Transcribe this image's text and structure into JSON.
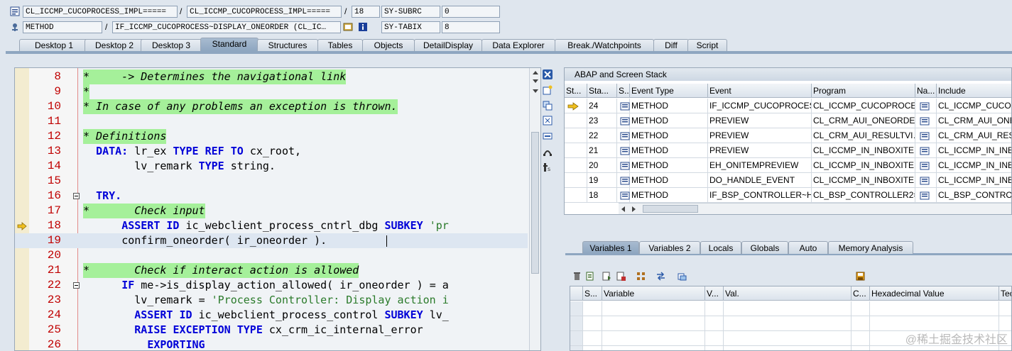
{
  "header": {
    "row1": {
      "program1": "CL_ICCMP_CUCOPROCESS_IMPL=====",
      "sep1": "/",
      "program2": "CL_ICCMP_CUCOPROCESS_IMPL=====",
      "sep2": "/",
      "line": "18",
      "var_name": "SY-SUBRC",
      "var_value": "0"
    },
    "row2": {
      "type": "METHOD",
      "sep": "/",
      "method": "IF_ICCMP_CUCOPROCESS~DISPLAY_ONEORDER (CL_IC…",
      "var_name": "SY-TABIX",
      "var_value": "8"
    }
  },
  "tabs": [
    "Desktop 1",
    "Desktop 2",
    "Desktop 3",
    "Standard",
    "Structures",
    "Tables",
    "Objects",
    "DetailDisplay",
    "Data Explorer",
    "Break./Watchpoints",
    "Diff",
    "Script"
  ],
  "active_tab": "Standard",
  "code_lines": [
    {
      "n": "8",
      "t": "*     -> Determines the navigational link",
      "c": true
    },
    {
      "n": "9",
      "t": "*",
      "c": true
    },
    {
      "n": "10",
      "t": "* In case of any problems an exception is thrown.",
      "c": true
    },
    {
      "n": "11",
      "t": "",
      "c": false
    },
    {
      "n": "12",
      "t": "* Definitions",
      "c": true
    },
    {
      "n": "13",
      "t": "  DATA: lr_ex TYPE REF TO cx_root,",
      "c": false
    },
    {
      "n": "14",
      "t": "        lv_remark TYPE string.",
      "c": false
    },
    {
      "n": "15",
      "t": "",
      "c": false
    },
    {
      "n": "16",
      "t": "  TRY.",
      "c": false
    },
    {
      "n": "17",
      "t": "*       Check input",
      "c": true
    },
    {
      "n": "18",
      "t": "      ASSERT ID ic_webclient_process_cntrl_dbg SUBKEY 'pr",
      "c": false
    },
    {
      "n": "19",
      "t": "      confirm_oneorder( ir_oneorder ).",
      "c": false
    },
    {
      "n": "20",
      "t": "",
      "c": false
    },
    {
      "n": "21",
      "t": "*       Check if interact action is allowed",
      "c": true
    },
    {
      "n": "22",
      "t": "      IF me->is_display_action_allowed( ir_oneorder ) = a",
      "c": false
    },
    {
      "n": "23",
      "t": "        lv_remark = 'Process Controller: Display action i",
      "c": false
    },
    {
      "n": "24",
      "t": "        ASSERT ID ic_webclient_process_control SUBKEY lv_",
      "c": false
    },
    {
      "n": "25",
      "t": "        RAISE EXCEPTION TYPE cx_crm_ic_internal_error",
      "c": false
    },
    {
      "n": "26",
      "t": "          EXPORTING",
      "c": false
    }
  ],
  "stack": {
    "title": "ABAP and Screen Stack",
    "columns": [
      "St...",
      "Sta...",
      "S...",
      "Event Type",
      "Event",
      "Program",
      "Na...",
      "Include"
    ],
    "rows": [
      {
        "st": "",
        "sta": "24",
        "type": "METHOD",
        "event": "IF_ICCMP_CUCOPROCES…",
        "program": "CL_ICCMP_CUCOPROCES…",
        "include": "CL_ICCMP_CUCOP"
      },
      {
        "st": "",
        "sta": "23",
        "type": "METHOD",
        "event": "PREVIEW",
        "program": "CL_CRM_AUI_ONEORDE…",
        "include": "CL_CRM_AUI_ONEC"
      },
      {
        "st": "",
        "sta": "22",
        "type": "METHOD",
        "event": "PREVIEW",
        "program": "CL_CRM_AUI_RESULTVI…",
        "include": "CL_CRM_AUI_RESU"
      },
      {
        "st": "",
        "sta": "21",
        "type": "METHOD",
        "event": "PREVIEW",
        "program": "CL_ICCMP_IN_INBOXITE…",
        "include": "CL_ICCMP_IN_INBO"
      },
      {
        "st": "",
        "sta": "20",
        "type": "METHOD",
        "event": "EH_ONITEMPREVIEW",
        "program": "CL_ICCMP_IN_INBOXITE…",
        "include": "CL_ICCMP_IN_INBO"
      },
      {
        "st": "",
        "sta": "19",
        "type": "METHOD",
        "event": "DO_HANDLE_EVENT",
        "program": "CL_ICCMP_IN_INBOXITE…",
        "include": "CL_ICCMP_IN_INBO"
      },
      {
        "st": "",
        "sta": "18",
        "type": "METHOD",
        "event": "IF_BSP_CONTROLLER~H…",
        "program": "CL_BSP_CONTROLLER2=…",
        "include": "CL_BSP_CONTROLL"
      }
    ]
  },
  "var_tabs": [
    "Variables 1",
    "Variables 2",
    "Locals",
    "Globals",
    "Auto",
    "Memory Analysis"
  ],
  "var_columns": [
    "S...",
    "Variable",
    "V...",
    "Val.",
    "C...",
    "Hexadecimal Value",
    "Tec"
  ],
  "watermark": "@稀土掘金技术社区",
  "colors": {
    "comment_bg": "#a5f09a",
    "keyword": "#0000d8",
    "line_number": "#c00000",
    "active_tab": "#8ea6c0"
  }
}
